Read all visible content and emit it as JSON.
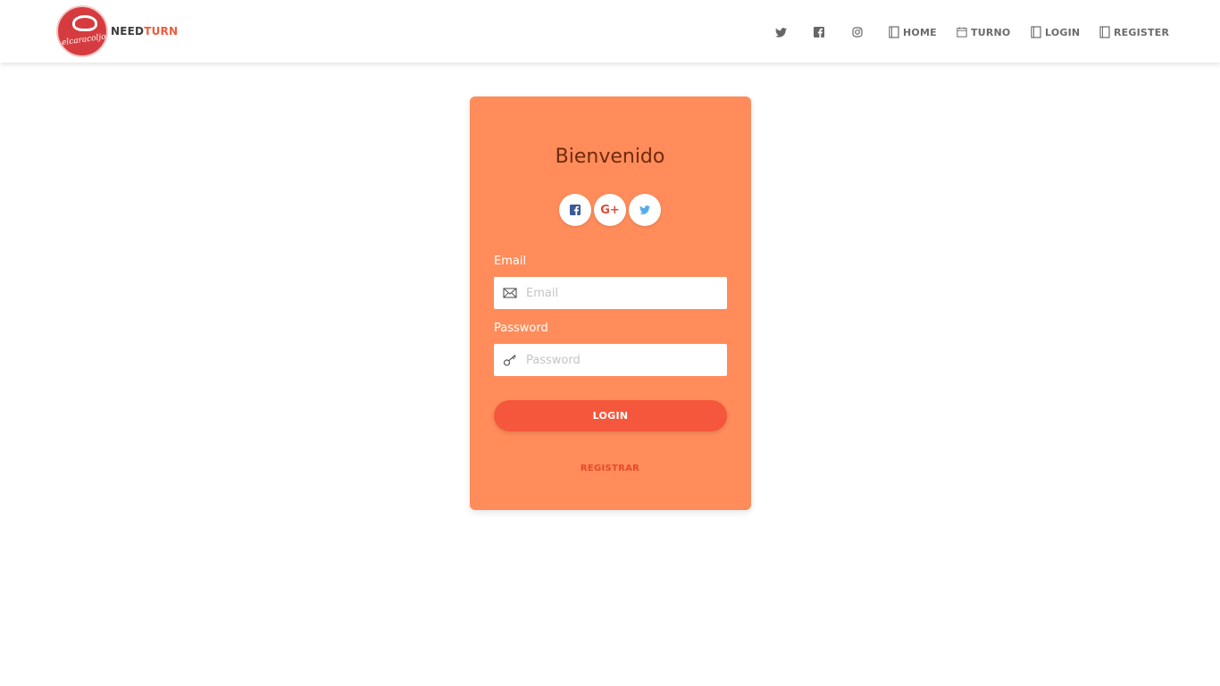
{
  "brand": {
    "logo_script": "elcaracoljo",
    "name_part1": "NEED",
    "name_part2": "TURN"
  },
  "nav": {
    "social": [
      {
        "name": "twitter-icon"
      },
      {
        "name": "facebook-icon"
      },
      {
        "name": "instagram-icon"
      }
    ],
    "links": [
      {
        "label": "HOME",
        "icon": "book-icon"
      },
      {
        "label": "TURNO",
        "icon": "calendar-icon"
      },
      {
        "label": "LOGIN",
        "icon": "book-icon"
      },
      {
        "label": "REGISTER",
        "icon": "book-icon"
      }
    ]
  },
  "card": {
    "title": "Bienvenido",
    "social": [
      {
        "name": "facebook-icon",
        "color": "#3b5998"
      },
      {
        "name": "google-plus-icon",
        "color": "#dd4b39",
        "glyph": "G+"
      },
      {
        "name": "twitter-icon",
        "color": "#55acee"
      }
    ],
    "email": {
      "label": "Email",
      "placeholder": "Email",
      "value": ""
    },
    "password": {
      "label": "Password",
      "placeholder": "Password",
      "value": ""
    },
    "login_label": "LOGIN",
    "register_label": "REGISTRAR"
  },
  "colors": {
    "card_bg": "#ff8c5a",
    "button": "#f4573b",
    "brand_accent": "#f05a3c",
    "title": "#6e2a0e",
    "link": "#e8482e"
  }
}
